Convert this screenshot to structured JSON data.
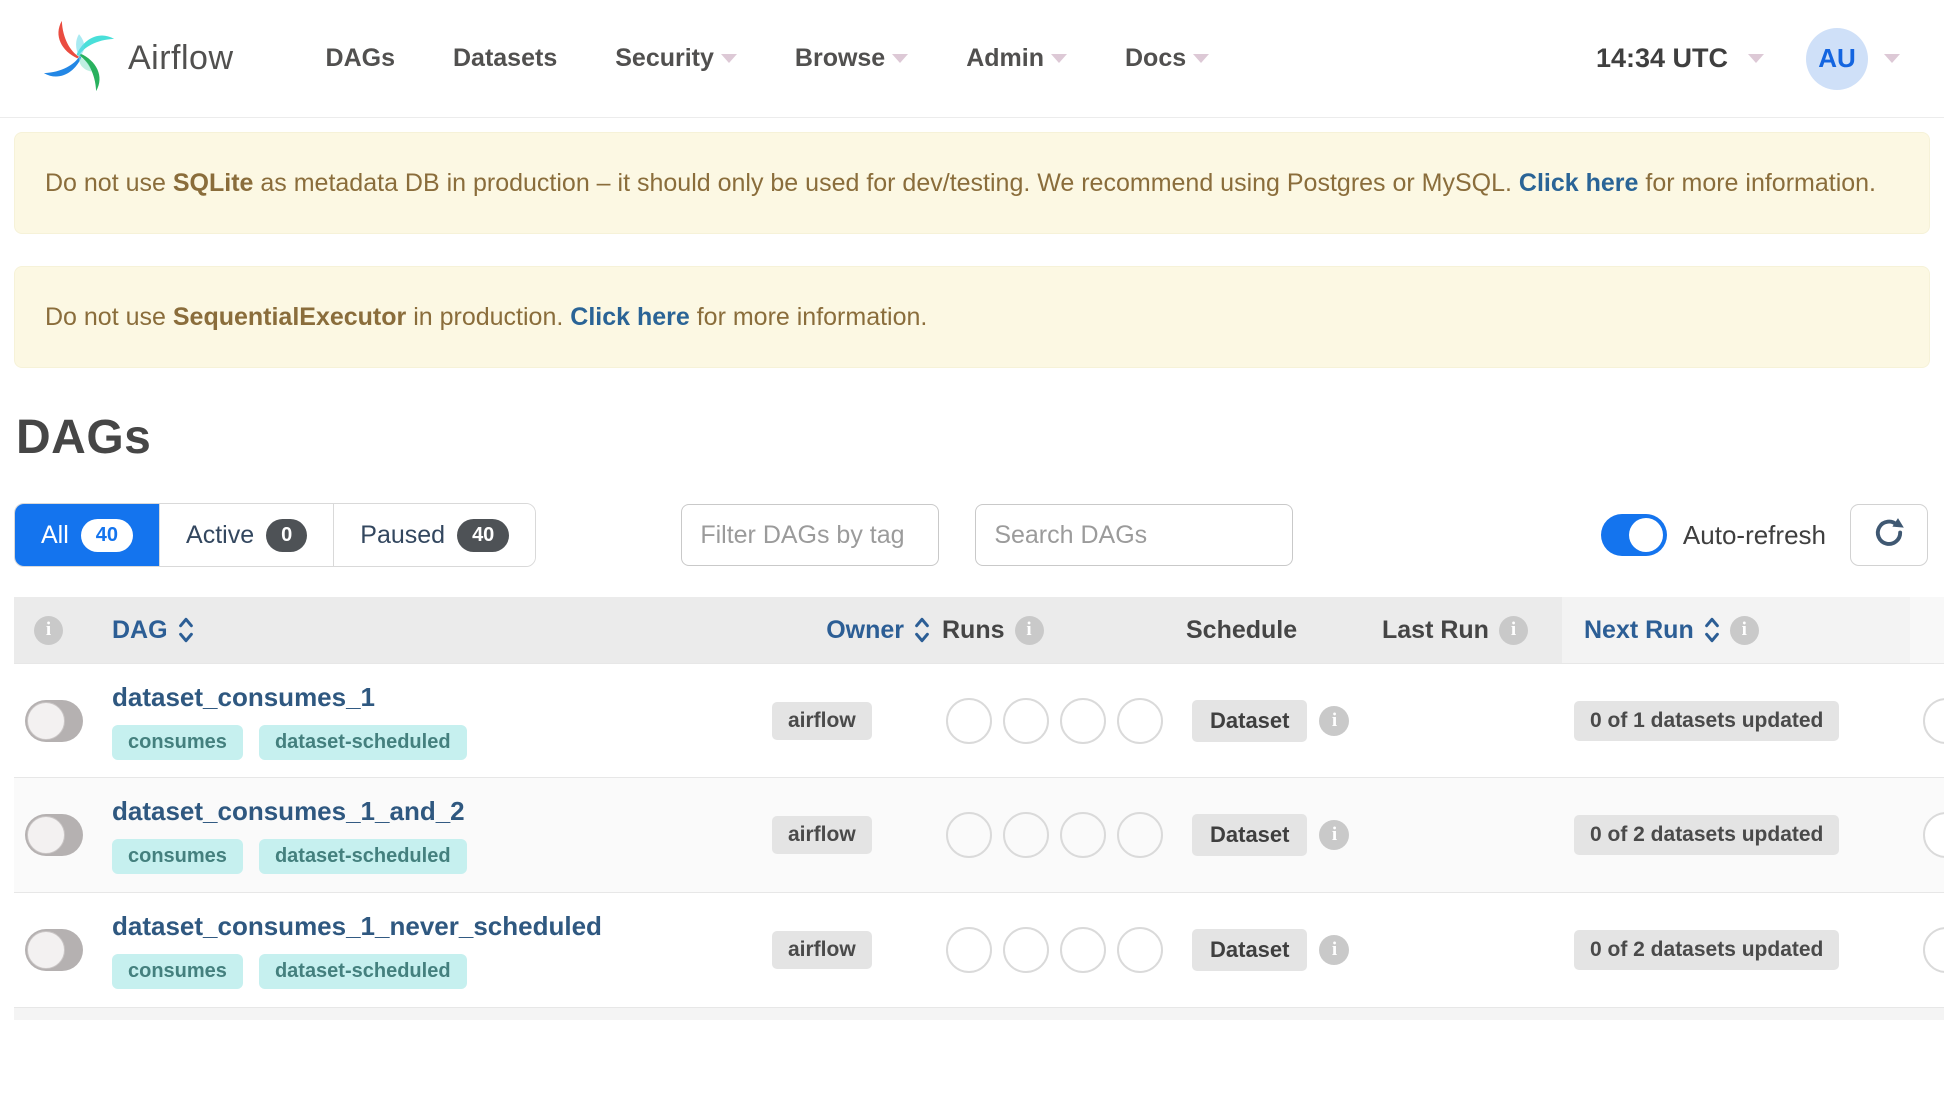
{
  "navbar": {
    "brand": "Airflow",
    "items": [
      {
        "label": "DAGs",
        "caret": false
      },
      {
        "label": "Datasets",
        "caret": false
      },
      {
        "label": "Security",
        "caret": true
      },
      {
        "label": "Browse",
        "caret": true
      },
      {
        "label": "Admin",
        "caret": true
      },
      {
        "label": "Docs",
        "caret": true
      }
    ],
    "clock": "14:34 UTC",
    "avatar_initials": "AU"
  },
  "banners": [
    {
      "prefix": "Do not use ",
      "strong": "SQLite",
      "middle": " as metadata DB in production – it should only be used for dev/testing. We recommend using Postgres or MySQL. ",
      "link": "Click here",
      "suffix": " for more information."
    },
    {
      "prefix": "Do not use ",
      "strong": "SequentialExecutor",
      "middle": " in production. ",
      "link": "Click here",
      "suffix": " for more information."
    }
  ],
  "page": {
    "title": "DAGs"
  },
  "filters": {
    "tabs": [
      {
        "label": "All",
        "count": "40"
      },
      {
        "label": "Active",
        "count": "0"
      },
      {
        "label": "Paused",
        "count": "40"
      }
    ],
    "tag_filter_placeholder": "Filter DAGs by tag",
    "search_placeholder": "Search DAGs",
    "auto_refresh_label": "Auto-refresh"
  },
  "table": {
    "headers": {
      "dag": "DAG",
      "owner": "Owner",
      "runs": "Runs",
      "schedule": "Schedule",
      "last_run": "Last Run",
      "next_run": "Next Run"
    },
    "rows": [
      {
        "name": "dataset_consumes_1",
        "tags": [
          "consumes",
          "dataset-scheduled"
        ],
        "owner": "airflow",
        "schedule": "Dataset",
        "next_run": "0 of 1 datasets updated"
      },
      {
        "name": "dataset_consumes_1_and_2",
        "tags": [
          "consumes",
          "dataset-scheduled"
        ],
        "owner": "airflow",
        "schedule": "Dataset",
        "next_run": "0 of 2 datasets updated"
      },
      {
        "name": "dataset_consumes_1_never_scheduled",
        "tags": [
          "consumes",
          "dataset-scheduled"
        ],
        "owner": "airflow",
        "schedule": "Dataset",
        "next_run": "0 of 2 datasets updated"
      }
    ]
  },
  "icons": {
    "info": "i"
  },
  "colors": {
    "accent_blue": "#1474ee",
    "banner_bg": "#fcf8e3",
    "banner_text": "#8a6d3b",
    "link_blue": "#2a6496",
    "tag_bg": "#c6f0ef",
    "tag_text": "#44807e",
    "sortable_header": "#2c5e95"
  }
}
